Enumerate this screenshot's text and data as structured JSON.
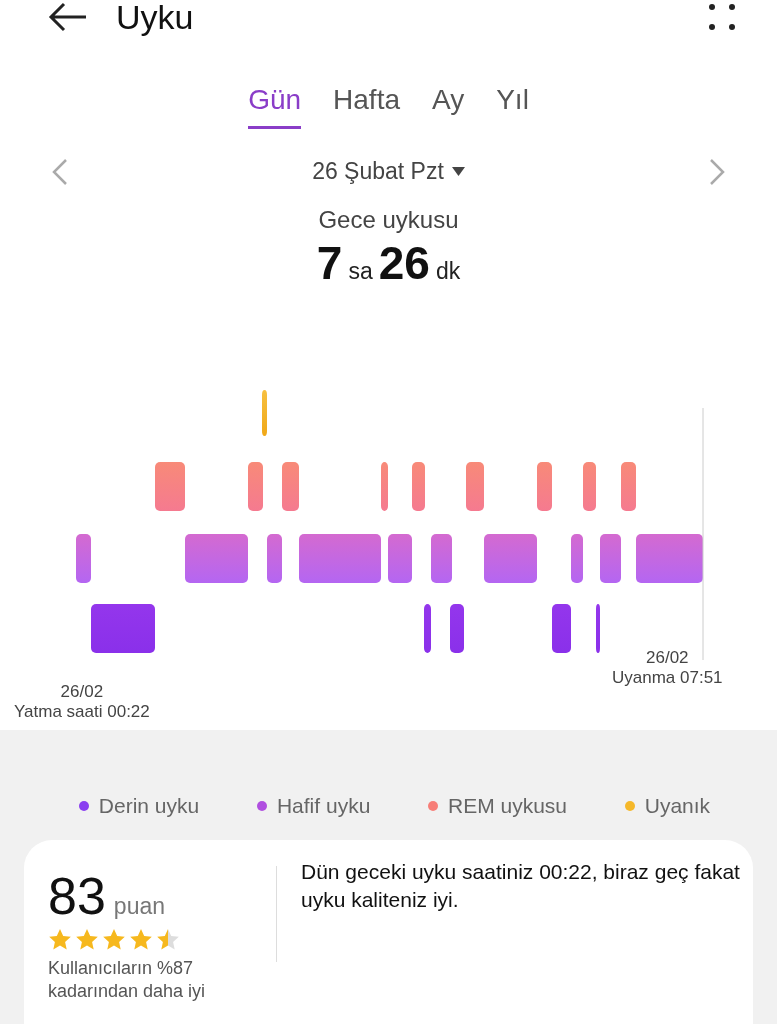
{
  "header": {
    "title": "Uyku"
  },
  "tabs": [
    {
      "label": "Gün",
      "selected": true
    },
    {
      "label": "Hafta",
      "selected": false
    },
    {
      "label": "Ay",
      "selected": false
    },
    {
      "label": "Yıl",
      "selected": false
    }
  ],
  "date_picker": {
    "date": "26 Şubat Pzt"
  },
  "summary": {
    "label": "Gece uykusu",
    "hours": "7",
    "hours_unit": "sa",
    "minutes": "26",
    "minutes_unit": "dk"
  },
  "chart": {
    "start_date": "26/02",
    "start_label": "Yatma saati 00:22",
    "end_date": "26/02",
    "end_label": "Uyanma 07:51"
  },
  "legend": [
    {
      "label": "Derin uyku",
      "color": "#8a3ff0"
    },
    {
      "label": "Hafif uyku",
      "color": "#b04fe0"
    },
    {
      "label": "REM uykusu",
      "color": "#f77e78"
    },
    {
      "label": "Uyanık",
      "color": "#f5b82a"
    }
  ],
  "score": {
    "value": "83",
    "unit": "puan",
    "stars": 4.5,
    "comparison": "Kullanıcıların %87 kadarından daha iyi",
    "comment": "Dün geceki uyku saatiniz 00:22, biraz geç fakat uyku kaliteniz iyi."
  }
}
